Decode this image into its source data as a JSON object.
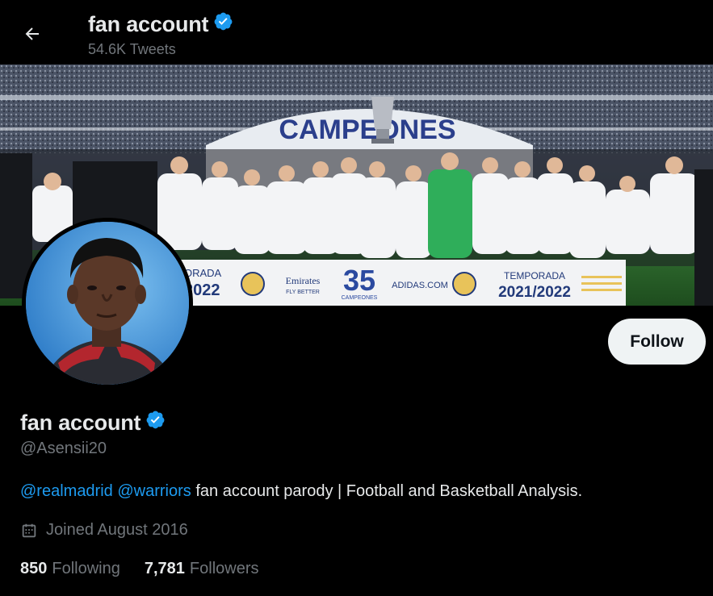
{
  "header": {
    "name": "fan account",
    "tweet_count": "54.6K Tweets"
  },
  "banner": {
    "arch_text": "CAMPEONES",
    "board_left_text_1": "ORADA",
    "board_left_text_2": "2022",
    "sponsor": "Emirates",
    "sponsor_sub": "FLY BETTER",
    "big_number": "35",
    "big_number_sub": "CAMPEONES",
    "adidas": "ADIDAS.COM",
    "temporada_label": "TEMPORADA",
    "temporada_years": "2021/2022"
  },
  "profile": {
    "name": "fan account",
    "handle": "@Asensii20",
    "bio_mention_1": "@realmadrid",
    "bio_mention_2": "@warriors",
    "bio_text": " fan account parody | Football and Basketball Analysis.",
    "joined": "Joined August 2016",
    "following_count": "850",
    "following_label": "Following",
    "followers_count": "7,781",
    "followers_label": "Followers"
  },
  "actions": {
    "follow_label": "Follow"
  },
  "colors": {
    "background": "#000000",
    "text_primary": "#e7e9ea",
    "text_secondary": "#71767b",
    "link": "#1d9bf0",
    "verified": "#1d9bf0",
    "follow_bg": "#eff3f4"
  },
  "icons": {
    "back": "arrow-left-icon",
    "verified": "verified-badge-icon",
    "calendar": "calendar-icon"
  }
}
